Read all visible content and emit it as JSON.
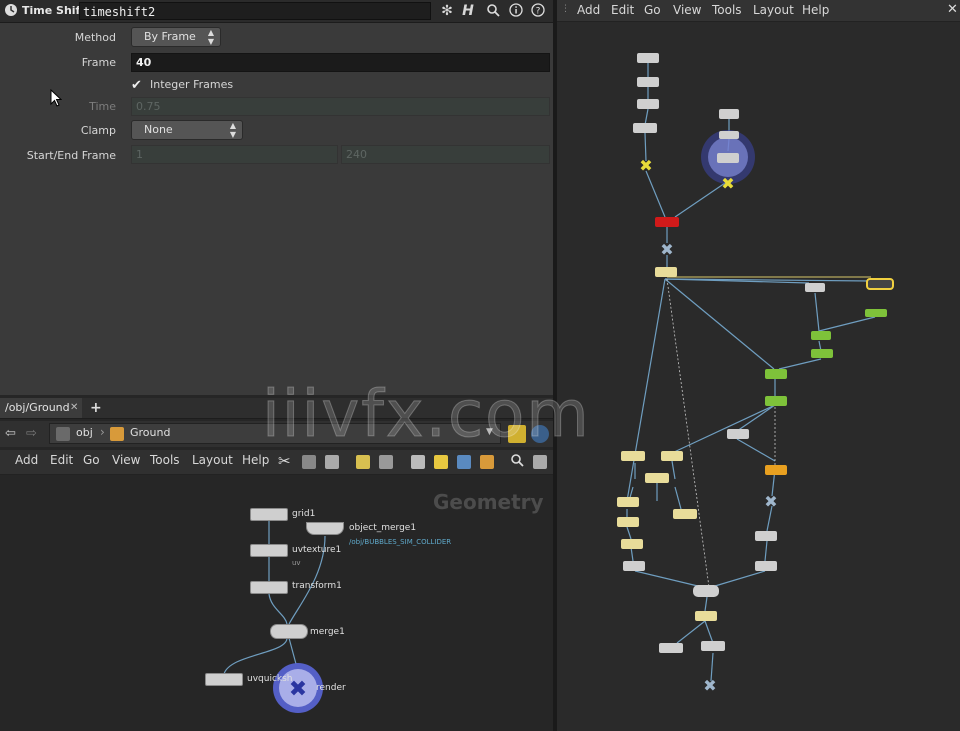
{
  "param_pane": {
    "node_type": "Time Shift",
    "node_name": "timeshift2",
    "header_icons": [
      "gear-icon",
      "help-h-icon",
      "search-icon",
      "info-icon",
      "help-question-icon"
    ],
    "params": {
      "method": {
        "label": "Method",
        "value": "By Frame"
      },
      "frame": {
        "label": "Frame",
        "value": "40"
      },
      "integer_frames": {
        "label": "Integer Frames",
        "checked": true
      },
      "time": {
        "label": "Time",
        "value": "0.75"
      },
      "clamp": {
        "label": "Clamp",
        "value": "None"
      },
      "start_end": {
        "label": "Start/End Frame",
        "start": "1",
        "end": "240"
      }
    }
  },
  "right_network": {
    "menu": [
      "Add",
      "Edit",
      "Go",
      "View",
      "Tools",
      "Layout",
      "Help"
    ]
  },
  "bottom_network": {
    "tab": "/obj/Ground",
    "path": [
      "obj",
      "Ground"
    ],
    "menu": [
      "Add",
      "Edit",
      "Go",
      "View",
      "Tools",
      "Layout",
      "Help"
    ],
    "context_label": "Geometry",
    "nodes": {
      "grid": "grid1",
      "object_merge": "object_merge1",
      "object_merge_path": "/obj/BUBBLES_SIM_COLLIDER",
      "uvtexture": "uvtexture1",
      "uvtexture_sub": "uv",
      "transform": "transform1",
      "merge": "merge1",
      "uvquickshade": "uvquicksh",
      "render": "render"
    }
  },
  "watermark": "iiivfx.com",
  "colors": {
    "node_yellow": "#e8dc3a",
    "node_green": "#7ec23a",
    "node_red": "#d11a1a",
    "node_blue": "#9fb6cc",
    "wire": "#6f9ec0",
    "render_ring": "#5a66d8"
  }
}
